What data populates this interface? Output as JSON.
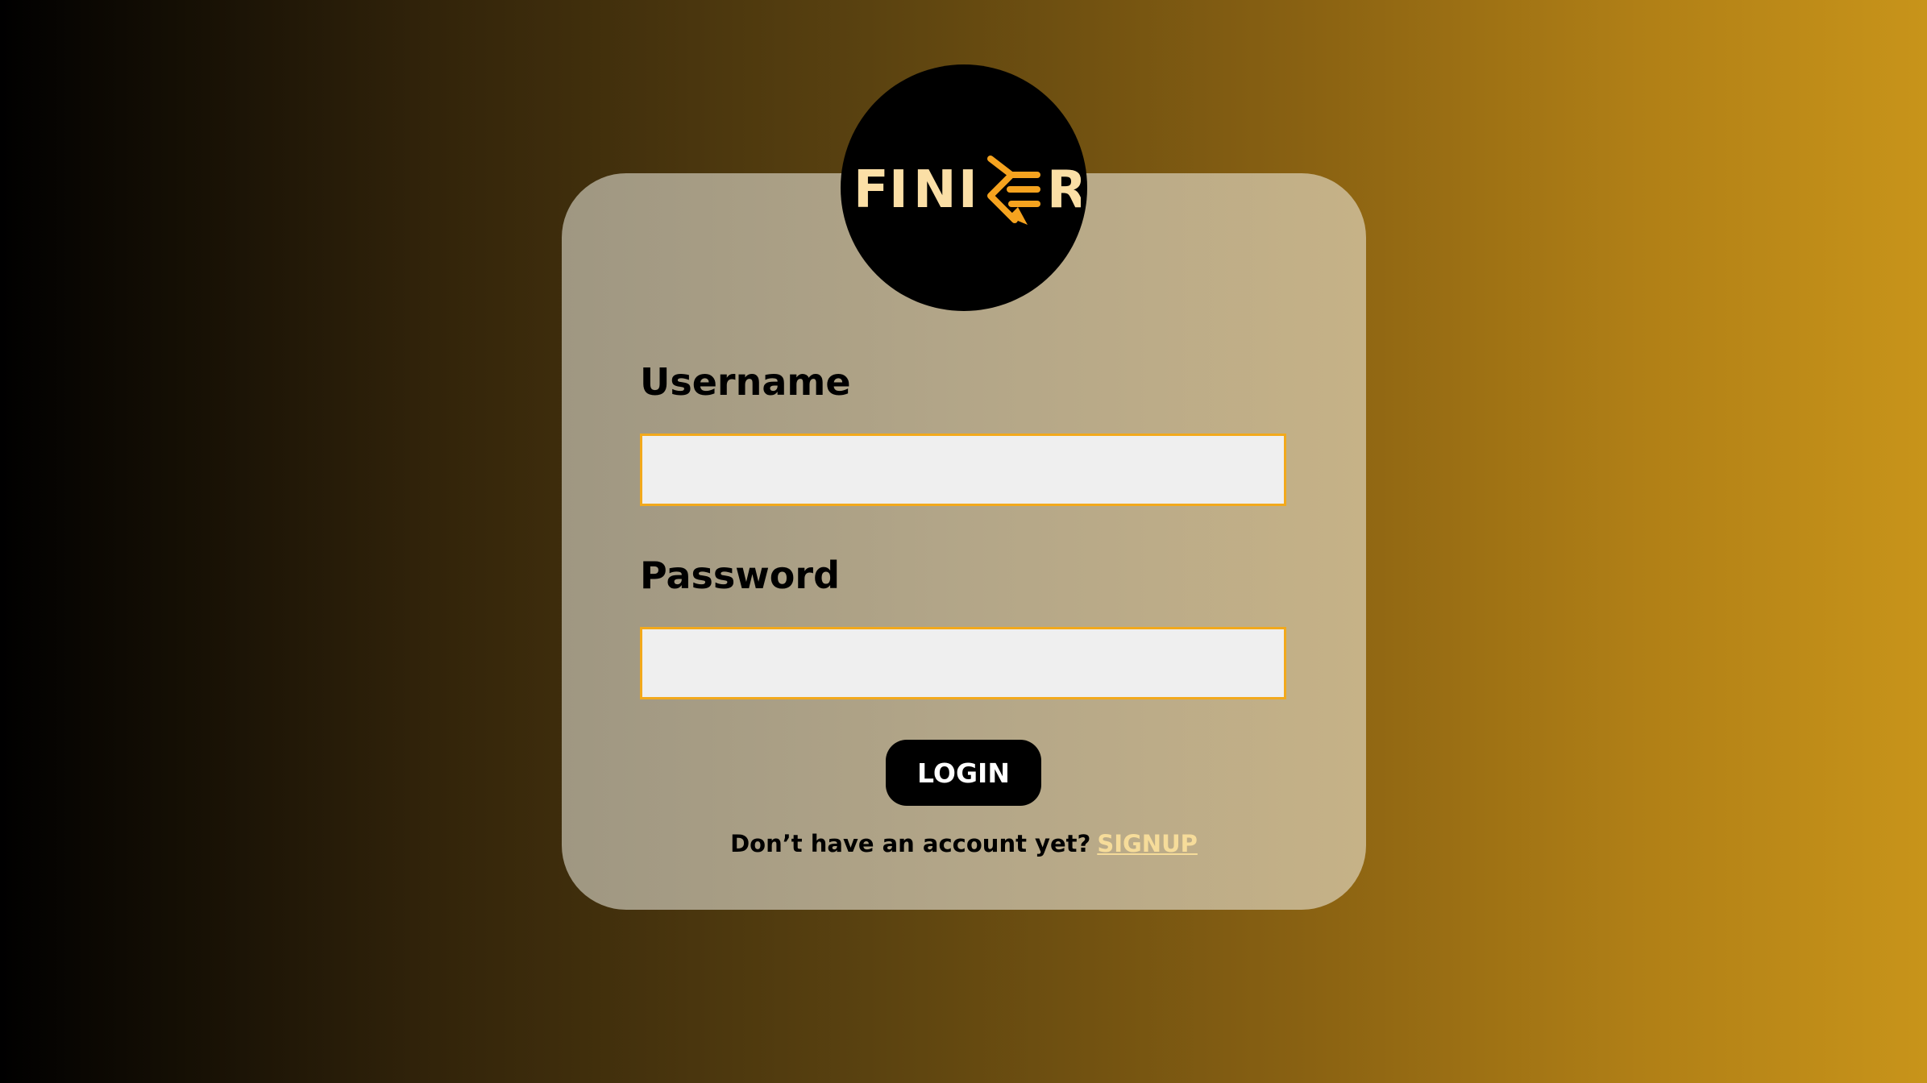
{
  "brand": {
    "logo_text": "FINIER",
    "logo_text_color": "#fbdfa6",
    "logo_accent_color": "#f5a31f",
    "badge_color": "#000000"
  },
  "form": {
    "username_label": "Username",
    "username_value": "",
    "password_label": "Password",
    "password_value": "",
    "input_border_color": "#f2a91c",
    "input_background": "#efefef"
  },
  "actions": {
    "login_label": "LOGIN",
    "signup_prompt": "Don’t have an account yet?",
    "signup_link": "SIGNUP",
    "signup_link_color": "#f6dc9a"
  },
  "colors": {
    "background_gradient": [
      "#000000",
      "#c8941a"
    ],
    "card_gradient": [
      "#9f9782",
      "#c6b287"
    ]
  }
}
